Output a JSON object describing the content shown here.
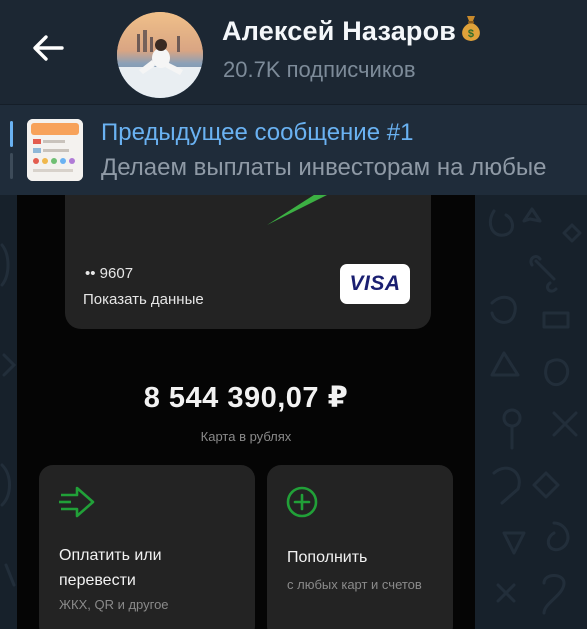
{
  "header": {
    "title": "Алексей Назаров",
    "title_emoji": "money-bag-icon",
    "subscribers": "20.7K подписчиков"
  },
  "pinned": {
    "title": "Предыдущее сообщение #1",
    "preview": "Делаем выплаты инвесторам на любые"
  },
  "media": {
    "card": {
      "number_masked": "•• 9607",
      "show_details": "Показать данные",
      "brand": "VISA"
    },
    "balance": "8 544 390,07 ₽",
    "balance_caption": "Карта в рублях",
    "actions": [
      {
        "title": "Оплатить или перевести",
        "subtitle": "ЖКХ, QR и другое",
        "icon": "transfer-arrow-icon"
      },
      {
        "title": "Пополнить",
        "subtitle": "с любых карт и счетов",
        "icon": "plus-circle-icon"
      }
    ]
  },
  "colors": {
    "header_bg": "#1c2733",
    "accent": "#6ab2f2",
    "green": "#21a038"
  }
}
